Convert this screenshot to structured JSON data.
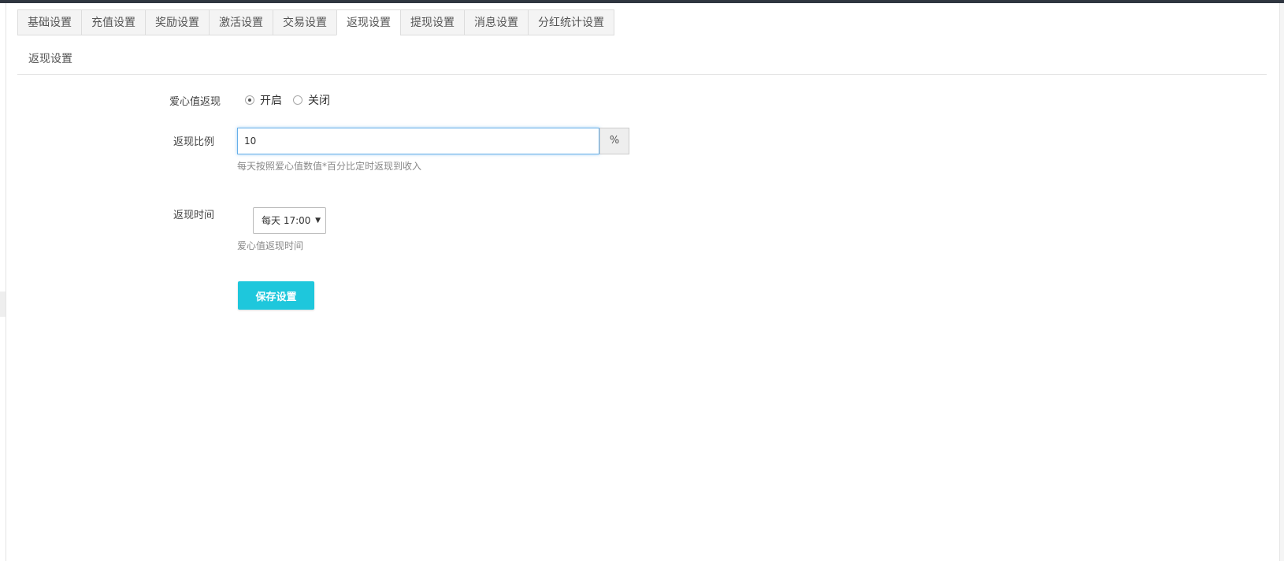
{
  "tabs": [
    {
      "label": "基础设置",
      "active": false
    },
    {
      "label": "充值设置",
      "active": false
    },
    {
      "label": "奖励设置",
      "active": false
    },
    {
      "label": "激活设置",
      "active": false
    },
    {
      "label": "交易设置",
      "active": false
    },
    {
      "label": "返现设置",
      "active": true
    },
    {
      "label": "提现设置",
      "active": false
    },
    {
      "label": "消息设置",
      "active": false
    },
    {
      "label": "分红统计设置",
      "active": false
    }
  ],
  "section_title": "返现设置",
  "form": {
    "cashback_toggle": {
      "label": "爱心值返现",
      "options": [
        "开启",
        "关闭"
      ],
      "selected": "开启"
    },
    "cashback_ratio": {
      "label": "返现比例",
      "value": "10",
      "unit": "%",
      "help": "每天按照爱心值数值*百分比定时返现到收入"
    },
    "cashback_time": {
      "label": "返现时间",
      "selected": "每天 17:00",
      "help": "爱心值返现时间"
    },
    "save_label": "保存设置"
  },
  "colors": {
    "accent": "#1ec7dc",
    "focus_border": "#66afe9",
    "topbar": "#2f3640"
  }
}
